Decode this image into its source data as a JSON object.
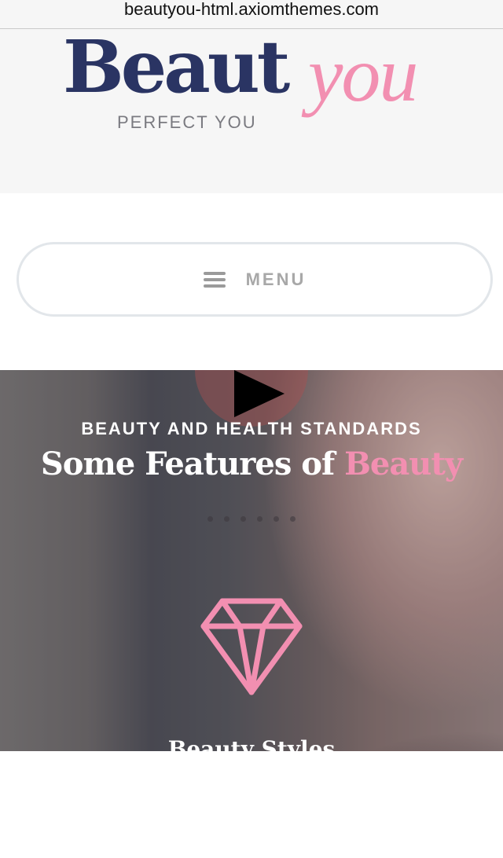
{
  "browser": {
    "url": "beautyou-html.axiomthemes.com"
  },
  "header": {
    "logo_primary": "Beaut",
    "logo_secondary": "you",
    "tagline": "PERFECT YOU"
  },
  "nav": {
    "menu_label": "MENU"
  },
  "hero": {
    "subtitle": "BEAUTY AND HEALTH STANDARDS",
    "title_main": "Some Features of",
    "title_accent": "Beauty",
    "feature_title": "Beauty Styles",
    "slider_dots": 6
  },
  "colors": {
    "brand_navy": "#2a3463",
    "brand_pink": "#f28fb1",
    "header_bg": "#f6f6f6"
  },
  "icons": [
    "hamburger-icon",
    "play-icon",
    "diamond-icon"
  ]
}
